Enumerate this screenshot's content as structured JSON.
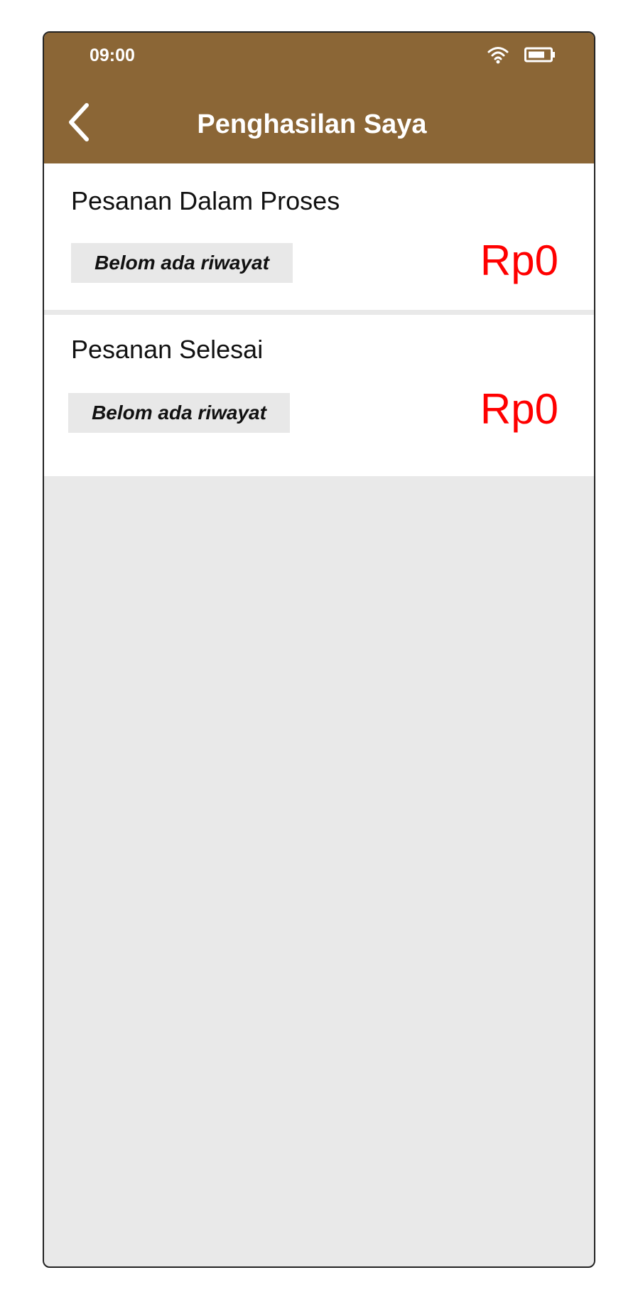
{
  "status_bar": {
    "time": "09:00",
    "wifi_icon": "wifi-icon",
    "battery_icon": "battery-icon"
  },
  "header": {
    "back_icon": "chevron-left-icon",
    "title": "Penghasilan Saya",
    "background_color": "#8b6636"
  },
  "sections": [
    {
      "title": "Pesanan Dalam Proses",
      "badge": "Belom ada riwayat",
      "amount": "Rp0"
    },
    {
      "title": "Pesanan Selesai",
      "badge": "Belom ada riwayat",
      "amount": "Rp0"
    }
  ],
  "colors": {
    "amount": "#ff0000",
    "badge_bg": "#e8e8e8",
    "page_bg": "#e9e9e9"
  }
}
